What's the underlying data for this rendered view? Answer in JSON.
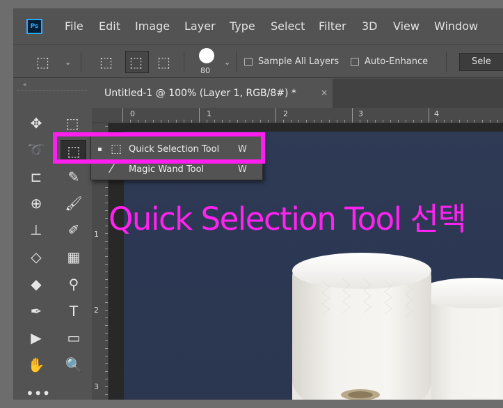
{
  "menubar": {
    "logo_text": "Ps",
    "items": [
      "File",
      "Edit",
      "Image",
      "Layer",
      "Type",
      "Select",
      "Filter",
      "3D",
      "View",
      "Window"
    ]
  },
  "options_bar": {
    "brush_size": "80",
    "sample_all_layers_label": "Sample All Layers",
    "sample_all_layers_checked": false,
    "auto_enhance_label": "Auto-Enhance",
    "auto_enhance_checked": false,
    "select_subject_label": "Sele"
  },
  "document": {
    "tab_title": "Untitled-1 @ 100% (Layer 1, RGB/8#) *",
    "tab_close": "×",
    "ruler_top_numbers": [
      "0",
      "1",
      "2",
      "3",
      "4"
    ],
    "ruler_left_numbers": [
      "1",
      "2",
      "3"
    ]
  },
  "flyout": {
    "items": [
      {
        "label": "Quick Selection Tool",
        "shortcut": "W",
        "active": true
      },
      {
        "label": "Magic Wand Tool",
        "shortcut": "W",
        "active": false
      }
    ]
  },
  "annotation": {
    "text": "Quick Selection Tool 선택",
    "color": "#ff22f0"
  },
  "colors": {
    "panel": "#535353",
    "pasteboard": "#282828",
    "canvas_bg": "#2f3a55",
    "highlight": "#ff1ef0"
  }
}
